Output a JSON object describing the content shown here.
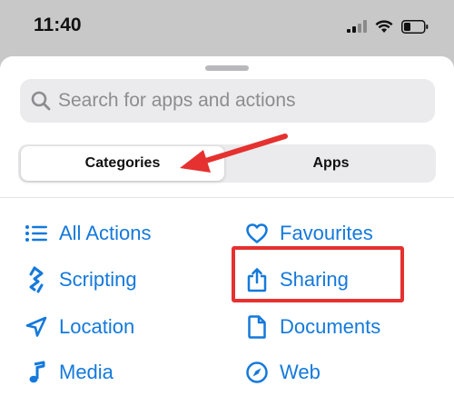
{
  "status_bar": {
    "time": "11:40"
  },
  "search": {
    "placeholder": "Search for apps and actions"
  },
  "tabs": [
    {
      "label": "Categories",
      "selected": true
    },
    {
      "label": "Apps",
      "selected": false
    }
  ],
  "categories": {
    "left": [
      {
        "label": "All Actions",
        "icon": "list-icon"
      },
      {
        "label": "Scripting",
        "icon": "scripting-icon"
      },
      {
        "label": "Location",
        "icon": "location-arrow-icon"
      },
      {
        "label": "Media",
        "icon": "music-note-icon"
      }
    ],
    "right": [
      {
        "label": "Favourites",
        "icon": "heart-icon"
      },
      {
        "label": "Sharing",
        "icon": "share-icon"
      },
      {
        "label": "Documents",
        "icon": "document-icon"
      },
      {
        "label": "Web",
        "icon": "compass-icon"
      }
    ]
  },
  "colors": {
    "accent": "#1479db",
    "annotation": "#e5312f"
  }
}
